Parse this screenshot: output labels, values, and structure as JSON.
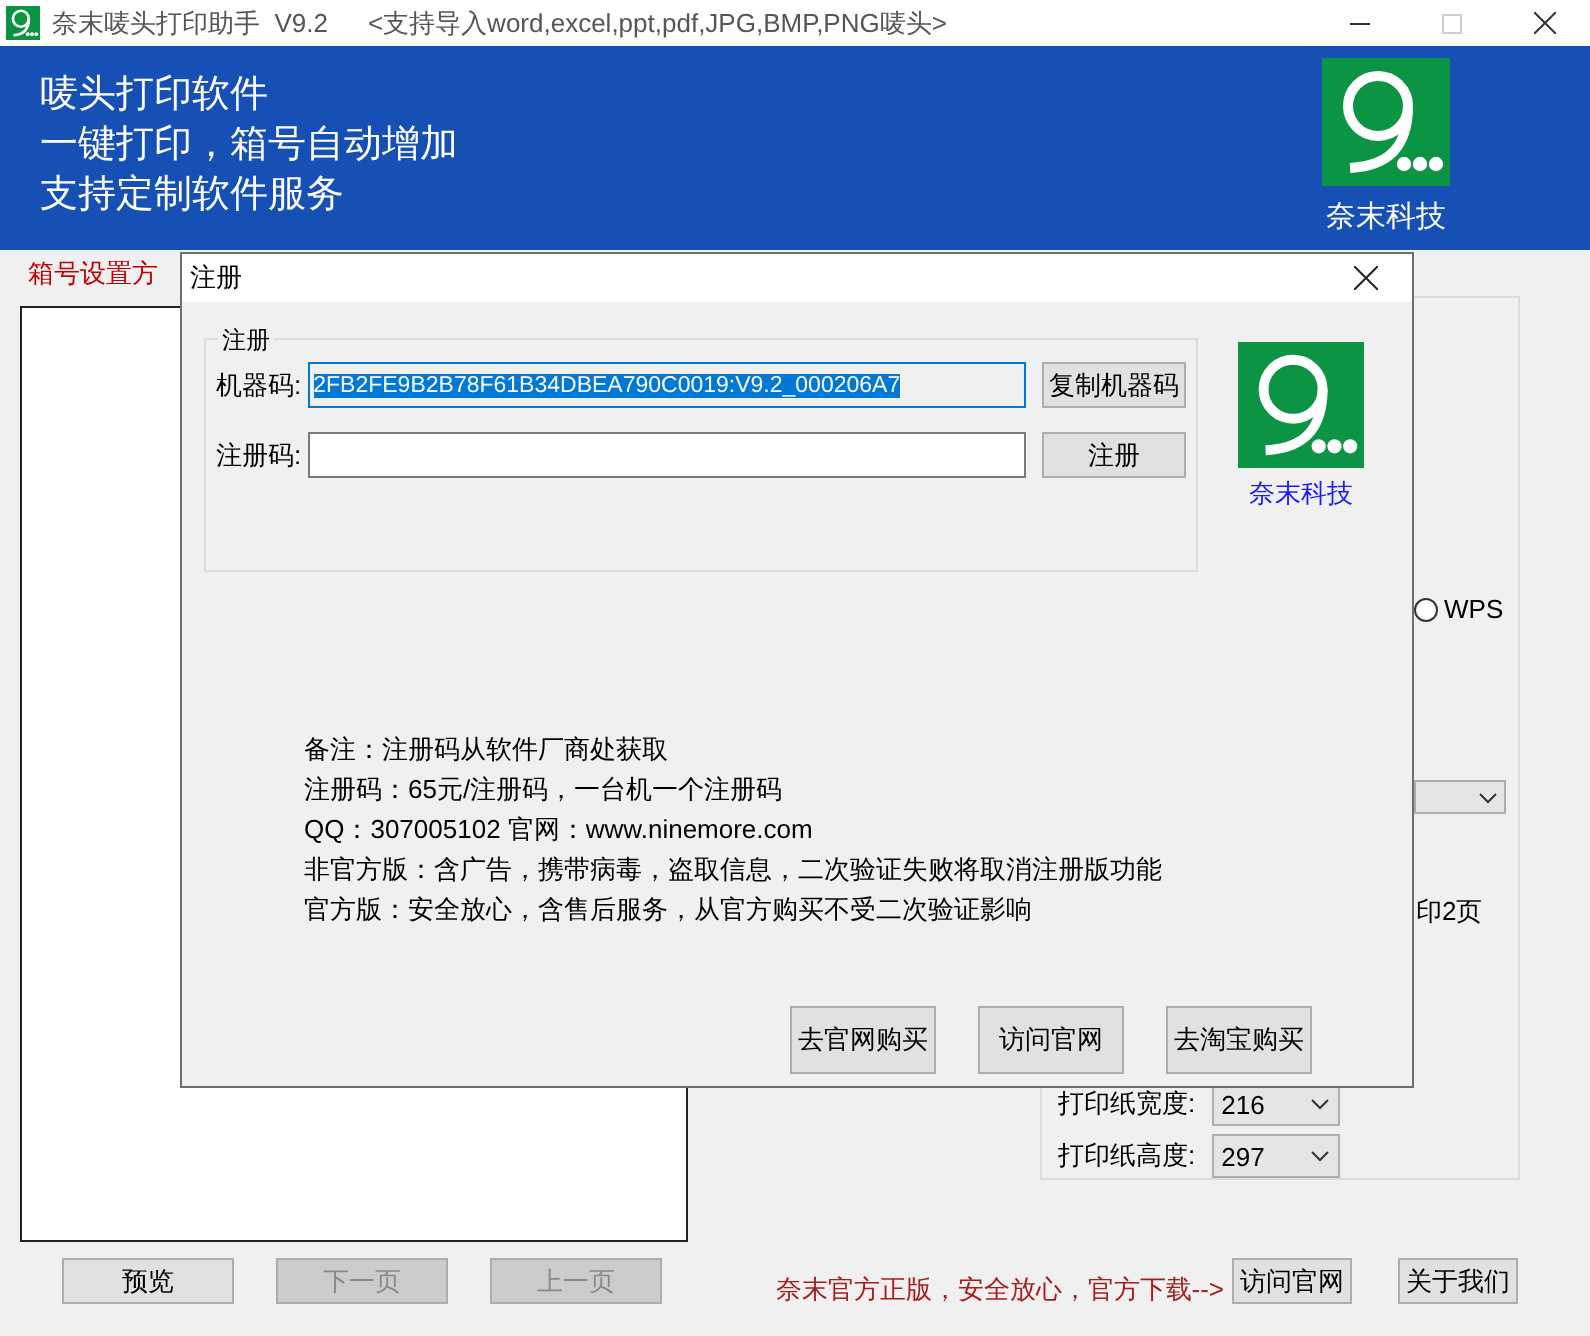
{
  "window": {
    "title": "奈末唛头打印助手  V9.2",
    "subtitle": "<支持导入word,excel,ppt,pdf,JPG,BMP,PNG唛头>"
  },
  "banner": {
    "lines": [
      "唛头打印软件",
      "一键打印，箱号自动增加",
      "支持定制软件服务"
    ],
    "brand": "奈末科技"
  },
  "left_panel": {
    "label": "箱号设置方"
  },
  "settings": {
    "radio": {
      "label": "WPS",
      "selected": false
    },
    "page_option": "印2页",
    "paper_width": {
      "label": "打印纸宽度:",
      "value": "216"
    },
    "paper_height": {
      "label": "打印纸高度:",
      "value": "297"
    }
  },
  "bottom_bar": {
    "buttons": [
      {
        "label": "预览",
        "disabled": false
      },
      {
        "label": "下一页",
        "disabled": true
      },
      {
        "label": "上一页",
        "disabled": true
      }
    ],
    "notice": "奈末官方正版，安全放心，官方下载-->",
    "links": [
      "访问官网",
      "关于我们"
    ]
  },
  "dialog": {
    "title": "注册",
    "group_title": "注册",
    "machine_code": {
      "label": "机器码:",
      "value": "2FB2FE9B2B78F61B34DBEA790C0019:V9.2_000206A7",
      "selected": true,
      "button": "复制机器码"
    },
    "reg_code": {
      "label": "注册码:",
      "button": "注册"
    },
    "brand": "奈末科技",
    "notes": [
      "备注：注册码从软件厂商处获取",
      "注册码：65元/注册码，一台机一个注册码",
      "QQ：307005102 官网：www.ninemore.com",
      "非官方版：含广告，携带病毒，盗取信息，二次验证失败将取消注册版功能",
      "官方版：安全放心，含售后服务，从官方购买不受二次验证影响"
    ],
    "buttons": [
      "去官网购买",
      "访问官网",
      "去淘宝购买"
    ]
  }
}
